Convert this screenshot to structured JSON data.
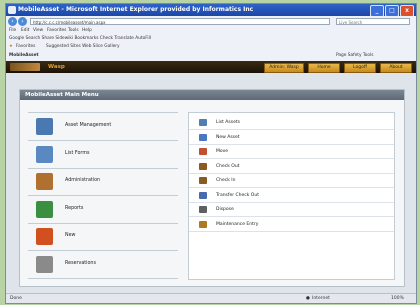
{
  "window": {
    "title": "MobileAsset - Microsoft Internet Explorer provided by Informatics Inc",
    "controls": [
      "_",
      "□",
      "x"
    ]
  },
  "browser": {
    "address": "http://c.c.c.c/mobileasset/main.aspx",
    "search_placeholder": "Live Search",
    "menu": [
      "File",
      "Edit",
      "View",
      "Favorites",
      "Tools",
      "Help"
    ],
    "links_bar": "Google  Search  Share  Sidewiki  Bookmarks  Check  Translate  AutoFill",
    "favorites_label": "Favorites",
    "favorites_items": "Suggested Sites  Web Slice Gallery",
    "tab_label": "MobileAsset",
    "tab_tools": "Page  Safety  Tools"
  },
  "app_header": {
    "brand": "Wasp",
    "buttons": [
      {
        "label": "Admin: Wasp"
      },
      {
        "label": "Home"
      },
      {
        "label": "Logoff"
      },
      {
        "label": "About"
      }
    ]
  },
  "main_menu": {
    "title": "MobileAsset Main Menu",
    "left_items": [
      {
        "label": "Asset Management",
        "icon": "asset-management-icon",
        "color": "#4a78b0"
      },
      {
        "label": "List Forms",
        "icon": "list-forms-icon",
        "color": "#5a88c0"
      },
      {
        "label": "Administration",
        "icon": "administration-icon",
        "color": "#b07030"
      },
      {
        "label": "Reports",
        "icon": "reports-icon",
        "color": "#3a9040"
      },
      {
        "label": "New",
        "icon": "new-icon",
        "color": "#d05020"
      },
      {
        "label": "Reservations",
        "icon": "reservations-icon",
        "color": "#8a8a8a"
      }
    ],
    "right_items": [
      {
        "label": "List Assets",
        "icon": "list-assets-icon",
        "color": "#5080b0"
      },
      {
        "label": "New Asset",
        "icon": "new-asset-icon",
        "color": "#4a78c0"
      },
      {
        "label": "Move",
        "icon": "move-icon",
        "color": "#c05030"
      },
      {
        "label": "Check Out",
        "icon": "check-out-icon",
        "color": "#8a5a20"
      },
      {
        "label": "Check In",
        "icon": "check-in-icon",
        "color": "#8a5a20"
      },
      {
        "label": "Transfer Check Out",
        "icon": "transfer-check-out-icon",
        "color": "#4a6ab0"
      },
      {
        "label": "Dispose",
        "icon": "dispose-icon",
        "color": "#606060"
      },
      {
        "label": "Maintenance Entry",
        "icon": "maintenance-entry-icon",
        "color": "#b07820"
      }
    ]
  },
  "status": {
    "left": "Done",
    "zone": "Internet",
    "zoom": "100%"
  },
  "colors": {
    "header_bg": "#2a1c0c",
    "header_button": "#e0a83a",
    "panel_title": "#6a7580"
  }
}
